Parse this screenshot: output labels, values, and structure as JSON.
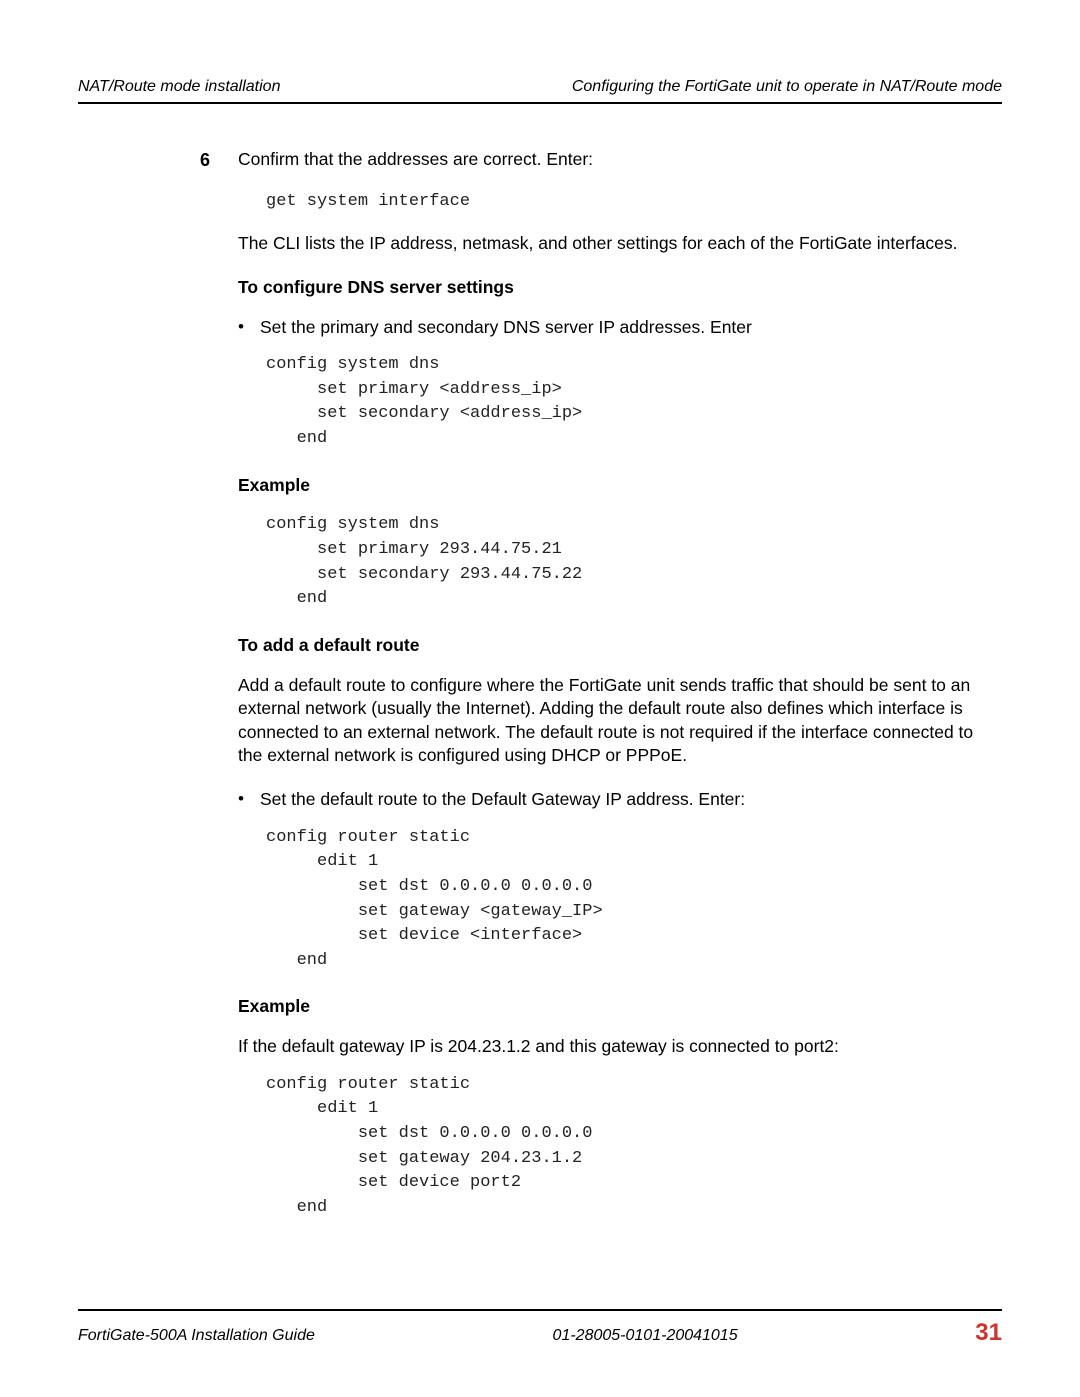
{
  "header": {
    "left": "NAT/Route mode installation",
    "right": "Configuring the FortiGate unit to operate in NAT/Route mode"
  },
  "step": {
    "number": "6",
    "text": "Confirm that the addresses are correct. Enter:"
  },
  "code1": "get system interface",
  "para1": "The CLI lists the IP address, netmask, and other settings for each of the FortiGate interfaces.",
  "heading1": "To configure DNS server settings",
  "bullet1": "Set the primary and secondary DNS server IP addresses. Enter",
  "code2": "config system dns\n     set primary <address_ip>\n     set secondary <address_ip>\n   end",
  "heading2": "Example",
  "code3": "config system dns\n     set primary 293.44.75.21\n     set secondary 293.44.75.22\n   end",
  "heading3": "To add a default route",
  "para2": "Add a default route to configure where the FortiGate unit sends traffic that should be sent to an external network (usually the Internet). Adding the default route also defines which interface is connected to an external network. The default route is not required if the interface connected to the external network is configured using DHCP or PPPoE.",
  "bullet2": "Set the default route to the Default Gateway IP address. Enter:",
  "code4": "config router static\n     edit 1\n         set dst 0.0.0.0 0.0.0.0\n         set gateway <gateway_IP>\n         set device <interface>\n   end",
  "heading4": "Example",
  "para3": "If the default gateway IP is 204.23.1.2 and this gateway is connected to port2:",
  "code5": "config router static\n     edit 1\n         set dst 0.0.0.0 0.0.0.0\n         set gateway 204.23.1.2\n         set device port2\n   end",
  "footer": {
    "left": "FortiGate-500A Installation Guide",
    "center": "01-28005-0101-20041015",
    "page": "31"
  }
}
